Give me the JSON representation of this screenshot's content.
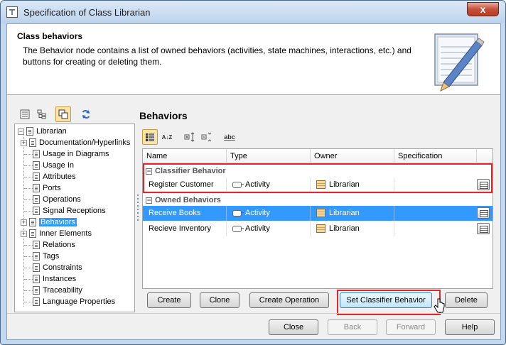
{
  "window": {
    "title": "Specification of Class Librarian",
    "close_glyph": "x"
  },
  "header": {
    "title": "Class behaviors",
    "description": "The Behavior node contains a list of owned behaviors (activities, state machines, interactions, etc.) and buttons for creating or deleting them."
  },
  "tree": {
    "root": "Librarian",
    "items": [
      {
        "label": "Documentation/Hyperlinks",
        "expander": "+"
      },
      {
        "label": "Usage in Diagrams",
        "expander": ""
      },
      {
        "label": "Usage In",
        "expander": ""
      },
      {
        "label": "Attributes",
        "expander": ""
      },
      {
        "label": "Ports",
        "expander": ""
      },
      {
        "label": "Operations",
        "expander": ""
      },
      {
        "label": "Signal Receptions",
        "expander": ""
      },
      {
        "label": "Behaviors",
        "expander": "+"
      },
      {
        "label": "Inner Elements",
        "expander": "+"
      },
      {
        "label": "Relations",
        "expander": ""
      },
      {
        "label": "Tags",
        "expander": ""
      },
      {
        "label": "Constraints",
        "expander": ""
      },
      {
        "label": "Instances",
        "expander": ""
      },
      {
        "label": "Traceability",
        "expander": ""
      },
      {
        "label": "Language Properties",
        "expander": ""
      }
    ],
    "selected": "Behaviors"
  },
  "panel": {
    "title": "Behaviors",
    "sort_glyph": "A↓Z",
    "spell_glyph": "abc"
  },
  "table": {
    "columns": [
      "Name",
      "Type",
      "Owner",
      "Specification"
    ],
    "groups": [
      {
        "title": "Classifier Behavior",
        "toggle": "−",
        "rows": [
          {
            "name": "Register Customer",
            "type": "Activity",
            "owner": "Librarian",
            "specification": "",
            "selected": false
          }
        ]
      },
      {
        "title": "Owned Behaviors",
        "toggle": "−",
        "rows": [
          {
            "name": "Receive Books",
            "type": "Activity",
            "owner": "Librarian",
            "specification": "",
            "selected": true
          },
          {
            "name": "Recieve Inventory",
            "type": "Activity",
            "owner": "Librarian",
            "specification": "",
            "selected": false
          }
        ]
      }
    ]
  },
  "actions": {
    "create": "Create",
    "clone": "Clone",
    "create_operation": "Create Operation",
    "set_classifier_behavior": "Set Classifier Behavior",
    "delete": "Delete"
  },
  "footer": {
    "close": "Close",
    "back": "Back",
    "forward": "Forward",
    "help": "Help"
  },
  "colors": {
    "selection": "#3399ff",
    "highlight_box": "#e0272d",
    "titlebar": "#c3d8ee"
  }
}
